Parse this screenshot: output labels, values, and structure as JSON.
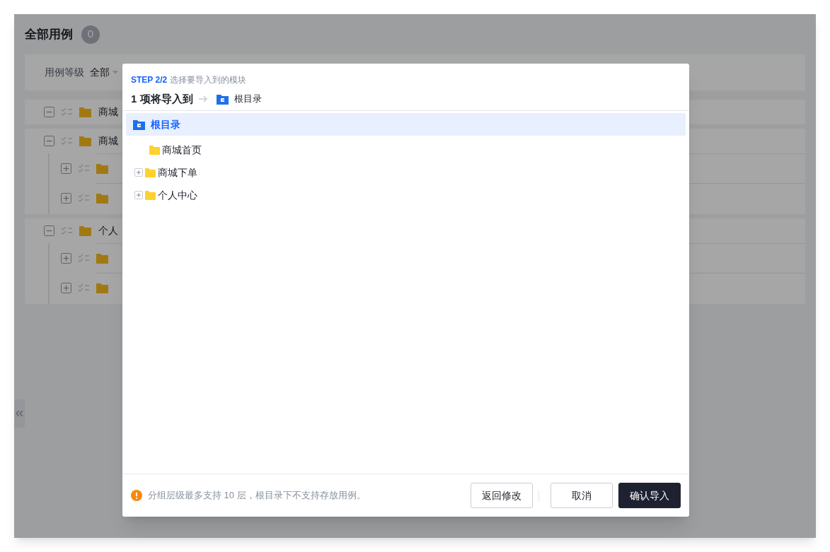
{
  "page": {
    "title": "全部用例",
    "count": "0",
    "filter": {
      "label": "用例等级",
      "value": "全部"
    },
    "groups": [
      {
        "name": "商城",
        "expanded": true
      },
      {
        "name": "商城",
        "expanded": true,
        "children": [
          {
            "expanded": false
          },
          {
            "expanded": false
          }
        ]
      },
      {
        "name": "个人",
        "expanded": true,
        "children": [
          {
            "expanded": false
          },
          {
            "expanded": false
          }
        ]
      }
    ]
  },
  "dialog": {
    "step": "STEP 2/2",
    "step_text": "选择要导入到的模块",
    "title": "1 项将导入到",
    "target": "根目录",
    "tree": [
      {
        "label": "根目录",
        "kind": "root",
        "selected": true,
        "children": [
          {
            "label": "商城首页",
            "kind": "folder",
            "selected": false,
            "expandable": false
          },
          {
            "label": "商城下单",
            "kind": "folder",
            "selected": false,
            "expandable": true
          },
          {
            "label": "个人中心",
            "kind": "folder",
            "selected": false,
            "expandable": true
          }
        ]
      }
    ],
    "note": "分组层级最多支持 10 层，根目录下不支持存放用例。",
    "buttons": [
      {
        "label": "返回修改",
        "kind": "secondary"
      },
      {
        "label": "取消",
        "kind": "secondary"
      },
      {
        "label": "确认导入",
        "kind": "primary"
      }
    ]
  }
}
